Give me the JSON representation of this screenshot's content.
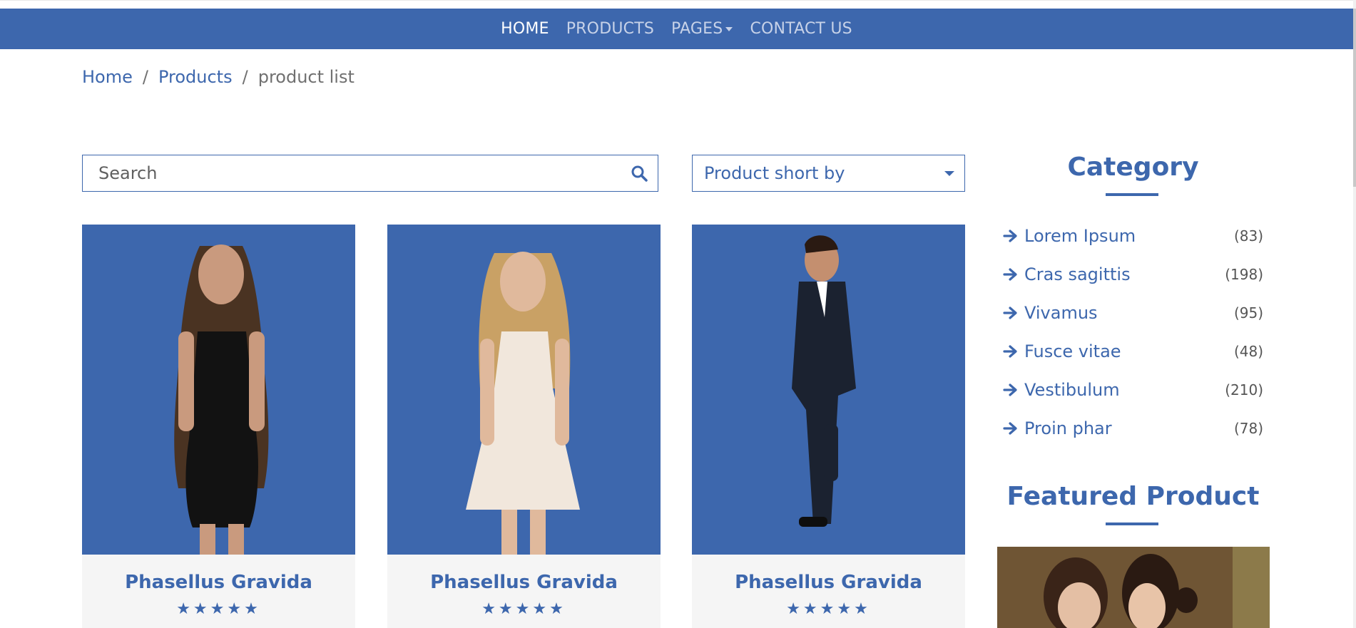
{
  "nav": {
    "items": [
      {
        "label": "HOME",
        "active": true
      },
      {
        "label": "PRODUCTS",
        "active": false
      },
      {
        "label": "PAGES",
        "active": false
      },
      {
        "label": "CONTACT US",
        "active": false
      }
    ]
  },
  "breadcrumb": {
    "home": "Home",
    "products": "Products",
    "current": "product list",
    "separator": "/"
  },
  "search": {
    "placeholder": "Search",
    "value": ""
  },
  "sort": {
    "label": "Product short by"
  },
  "products": [
    {
      "name": "Phasellus Gravida",
      "stars": "★★★★★"
    },
    {
      "name": "Phasellus Gravida",
      "stars": "★★★★★"
    },
    {
      "name": "Phasellus Gravida",
      "stars": "★★★★★"
    }
  ],
  "sidebar": {
    "category_title": "Category",
    "categories": [
      {
        "label": "Lorem Ipsum",
        "count": "(83)"
      },
      {
        "label": "Cras sagittis",
        "count": "(198)"
      },
      {
        "label": "Vivamus",
        "count": "(95)"
      },
      {
        "label": "Fusce vitae",
        "count": "(48)"
      },
      {
        "label": "Vestibulum",
        "count": "(210)"
      },
      {
        "label": "Proin phar",
        "count": "(78)"
      }
    ],
    "featured_title": "Featured Product"
  },
  "colors": {
    "brand": "#3d67ad",
    "card_bg": "#f5f5f5"
  }
}
